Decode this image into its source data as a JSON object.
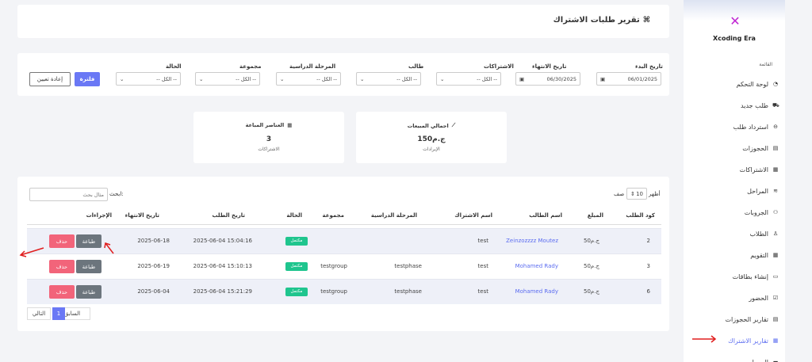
{
  "sidebar": {
    "brand": "Xcoding Era",
    "menu_title": "القائمة",
    "items": [
      {
        "label": "لوحة التحكم",
        "icon": "dashboard-icon",
        "glyph": "◔"
      },
      {
        "label": "طلب جديد",
        "icon": "cart-icon",
        "glyph": "⛟"
      },
      {
        "label": "استرداد طلب",
        "icon": "minus-circle-icon",
        "glyph": "⊖"
      },
      {
        "label": "الحجوزات",
        "icon": "book-icon",
        "glyph": "▤"
      },
      {
        "label": "الاشتراكات",
        "icon": "calendar-icon",
        "glyph": "▦"
      },
      {
        "label": "المراحل",
        "icon": "layers-icon",
        "glyph": "≋"
      },
      {
        "label": "الجروبات",
        "icon": "users-icon",
        "glyph": "⚇"
      },
      {
        "label": "الطلاب",
        "icon": "student-icon",
        "glyph": "♙"
      },
      {
        "label": "التقويم",
        "icon": "calendar-icon",
        "glyph": "▦"
      },
      {
        "label": "إنشاء بطاقات",
        "icon": "id-card-icon",
        "glyph": "▭"
      },
      {
        "label": "الحضور",
        "icon": "calendar-check-icon",
        "glyph": "☑"
      },
      {
        "label": "تقارير الحجوزات",
        "icon": "book-icon",
        "glyph": "▤"
      },
      {
        "label": "تقارير الاشتراك",
        "icon": "calendar-icon",
        "glyph": "▦"
      },
      {
        "label": "المبيعات",
        "icon": "money-icon",
        "glyph": "▬"
      }
    ],
    "active_index": 12
  },
  "header": {
    "title": "تقرير طلبات الاشتراك",
    "icon_glyph": "⌘"
  },
  "filters": {
    "start_label": "تاريخ البدء",
    "start_value": "06/01/2025",
    "end_label": "تاريخ الانتهاء",
    "end_value": "06/30/2025",
    "subs_label": "الاشتراكات",
    "subs_value": "-- الكل --",
    "student_label": "طالب",
    "student_value": "-- الكل --",
    "phase_label": "المرحلة الدراسية",
    "phase_value": "-- الكل --",
    "group_label": "مجموعة",
    "group_value": "-- الكل --",
    "status_label": "الحالة",
    "status_value": "-- الكل --",
    "filter_btn": "فلترة",
    "reset_btn": "إعادة تعيين"
  },
  "stats": {
    "sales_title": "اجمالي المبيعات",
    "sales_value": "150ج.م",
    "sales_sub": "الإيرادات",
    "items_title": "العناصر المباعة",
    "items_value": "3",
    "items_sub": "الاشتراكات"
  },
  "table": {
    "show_label": "أظهر",
    "show_value": "10",
    "rows_label": "صف",
    "search_label": "ابحث:",
    "search_placeholder": "مثال بحث",
    "headers": [
      "كود الطلب",
      "المبلغ",
      "اسم الطالب",
      "اسم الاشتراك",
      "المرحلة الدراسية",
      "مجموعة",
      "الحالة",
      "تاريخ الطلب",
      "تاريخ الانتهاء",
      "الإجراءات"
    ],
    "rows": [
      {
        "code": "2",
        "amount": "50ج.م",
        "student": "Zeinzozzzz Moutez",
        "sub": "test",
        "phase": "",
        "group": "",
        "status": "مكتمل",
        "date": "2025-06-04 15:04:16",
        "end": "2025-06-18"
      },
      {
        "code": "3",
        "amount": "50ج.م",
        "student": "Mohamed Rady",
        "sub": "test",
        "phase": "testphase",
        "group": "testgroup",
        "status": "مكتمل",
        "date": "2025-06-04 15:10:13",
        "end": "2025-06-19"
      },
      {
        "code": "6",
        "amount": "50ج.م",
        "student": "Mohamed Rady",
        "sub": "test",
        "phase": "testphase",
        "group": "testgroup",
        "status": "مكتمل",
        "date": "2025-06-04 15:21:29",
        "end": "2025-06-04"
      }
    ],
    "print_btn": "طباعة",
    "delete_btn": "حذف",
    "prev": "السابق",
    "page": "1",
    "next": "التالي"
  }
}
